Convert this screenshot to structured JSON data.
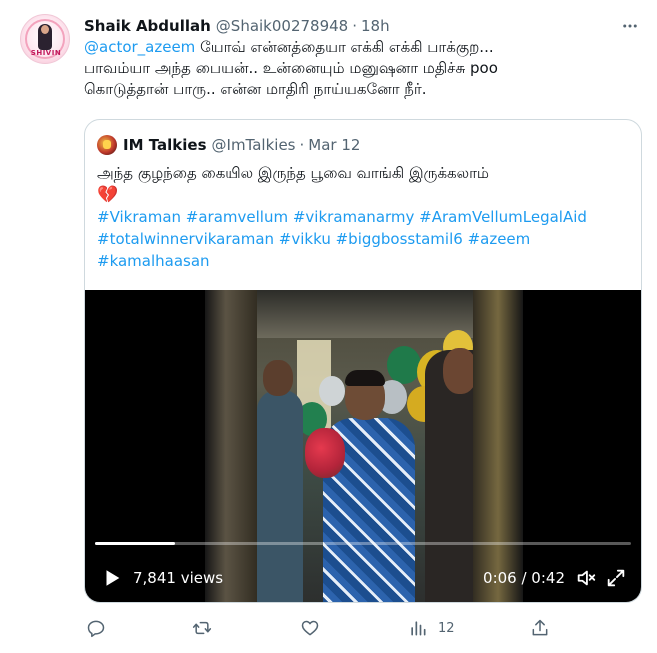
{
  "tweet": {
    "author_name": "Shaik Abdullah",
    "author_handle": "@Shaik00278948",
    "separator": "·",
    "time": "18h",
    "more_icon": "more-horizontal-icon",
    "avatar_text": "SHIVIN",
    "text_mention": "@actor_azeem",
    "text_line1_rest": " யோவ் என்னத்தையா எக்கி எக்கி பாக்குற...",
    "text_line2": "பாவம்யா அந்த பையன்.. உன்னையும் மனுஷனா மதிச்சு poo",
    "text_line3": "கொடுத்தான் பாரு.. என்ன மாதிரி நாய்யகனோ நீர்."
  },
  "quote": {
    "author_name": "IM Talkies",
    "author_handle": "@ImTalkies",
    "separator": "·",
    "time": "Mar 12",
    "text_line1": "அந்த குழந்தை கையில இருந்த பூவை வாங்கி இருக்கலாம்",
    "emoji": "💔",
    "hashtags_line1": "#Vikraman #aramvellum #vikramanarmy #AramVellumLegalAid",
    "hashtags_line2": "#totalwinnervikaraman #vikku #biggbosstamil6 #azeem",
    "hashtags_line3": "#kamalhaasan"
  },
  "video": {
    "views": "7,841 views",
    "timecode": "0:06 / 0:42",
    "progress": 0.15,
    "play_icon": "play-icon",
    "volume_icon": "volume-icon",
    "fullscreen_icon": "fullscreen-icon"
  },
  "actions": {
    "reply_icon": "reply-icon",
    "retweet_icon": "retweet-icon",
    "like_icon": "like-icon",
    "views_icon": "analytics-icon",
    "views_count": "12",
    "share_icon": "share-icon"
  },
  "colors": {
    "accent": "#1d9bf0",
    "secondary_text": "#536471",
    "border": "#cfd9de"
  }
}
